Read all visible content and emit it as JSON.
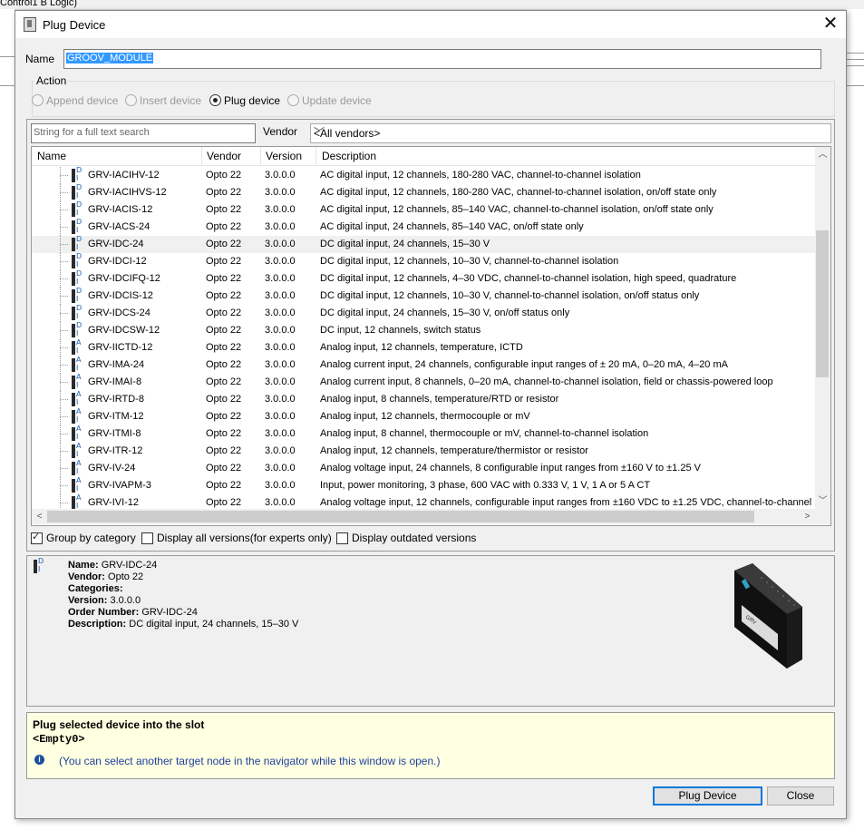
{
  "background": {
    "fragment": "Control1 B Logic)"
  },
  "dialog": {
    "title": "Plug Device"
  },
  "name_field": {
    "label": "Name",
    "value": "GROOV_MODULE"
  },
  "action": {
    "legend": "Action",
    "options": [
      {
        "label": "Append device",
        "selected": false,
        "enabled": false
      },
      {
        "label": "Insert device",
        "selected": false,
        "enabled": false
      },
      {
        "label": "Plug device",
        "selected": true,
        "enabled": true
      },
      {
        "label": "Update device",
        "selected": false,
        "enabled": false
      }
    ]
  },
  "search": {
    "placeholder": "String for a full text search"
  },
  "vendor": {
    "label": "Vendor",
    "selected": "<All vendors>"
  },
  "table": {
    "columns": [
      "Name",
      "Vendor",
      "Version",
      "Description"
    ],
    "selected_index": 4,
    "rows": [
      {
        "icon": "D",
        "name": "GRV-IACIHV-12",
        "vendor": "Opto 22",
        "version": "3.0.0.0",
        "description": "AC digital input, 12 channels, 180-280 VAC, channel-to-channel isolation"
      },
      {
        "icon": "D",
        "name": "GRV-IACIHVS-12",
        "vendor": "Opto 22",
        "version": "3.0.0.0",
        "description": "AC digital input, 12 channels, 180-280 VAC, channel-to-channel isolation, on/off state only"
      },
      {
        "icon": "D",
        "name": "GRV-IACIS-12",
        "vendor": "Opto 22",
        "version": "3.0.0.0",
        "description": "AC digital input, 12 channels, 85–140 VAC, channel-to-channel isolation, on/off state only"
      },
      {
        "icon": "D",
        "name": "GRV-IACS-24",
        "vendor": "Opto 22",
        "version": "3.0.0.0",
        "description": "AC digital input, 24 channels, 85–140 VAC, on/off state only"
      },
      {
        "icon": "D",
        "name": "GRV-IDC-24",
        "vendor": "Opto 22",
        "version": "3.0.0.0",
        "description": "DC digital input, 24 channels, 15–30 V"
      },
      {
        "icon": "D",
        "name": "GRV-IDCI-12",
        "vendor": "Opto 22",
        "version": "3.0.0.0",
        "description": "DC digital input, 12 channels, 10–30 V, channel-to-channel isolation"
      },
      {
        "icon": "D",
        "name": "GRV-IDCIFQ-12",
        "vendor": "Opto 22",
        "version": "3.0.0.0",
        "description": "DC digital input, 12 channels, 4–30 VDC, channel-to-channel isolation, high speed, quadrature"
      },
      {
        "icon": "D",
        "name": "GRV-IDCIS-12",
        "vendor": "Opto 22",
        "version": "3.0.0.0",
        "description": "DC digital input, 12 channels, 10–30 V, channel-to-channel isolation, on/off status only"
      },
      {
        "icon": "D",
        "name": "GRV-IDCS-24",
        "vendor": "Opto 22",
        "version": "3.0.0.0",
        "description": "DC digital input, 24 channels, 15–30 V, on/off status only"
      },
      {
        "icon": "D",
        "name": "GRV-IDCSW-12",
        "vendor": "Opto 22",
        "version": "3.0.0.0",
        "description": "DC input, 12 channels, switch status"
      },
      {
        "icon": "A",
        "name": "GRV-IICTD-12",
        "vendor": "Opto 22",
        "version": "3.0.0.0",
        "description": "Analog input, 12 channels, temperature, ICTD"
      },
      {
        "icon": "A",
        "name": "GRV-IMA-24",
        "vendor": "Opto 22",
        "version": "3.0.0.0",
        "description": "Analog current input, 24 channels, configurable input ranges of ± 20 mA, 0–20 mA, 4–20 mA"
      },
      {
        "icon": "A",
        "name": "GRV-IMAI-8",
        "vendor": "Opto 22",
        "version": "3.0.0.0",
        "description": "Analog current input, 8 channels, 0–20 mA, channel-to-channel isolation, field or chassis-powered loop"
      },
      {
        "icon": "A",
        "name": "GRV-IRTD-8",
        "vendor": "Opto 22",
        "version": "3.0.0.0",
        "description": "Analog input, 8 channels, temperature/RTD or resistor"
      },
      {
        "icon": "A",
        "name": "GRV-ITM-12",
        "vendor": "Opto 22",
        "version": "3.0.0.0",
        "description": "Analog input, 12 channels, thermocouple or mV"
      },
      {
        "icon": "A",
        "name": "GRV-ITMI-8",
        "vendor": "Opto 22",
        "version": "3.0.0.0",
        "description": "Analog input, 8 channel, thermocouple or mV, channel-to-channel isolation"
      },
      {
        "icon": "A",
        "name": "GRV-ITR-12",
        "vendor": "Opto 22",
        "version": "3.0.0.0",
        "description": "Analog input, 12 channels, temperature/thermistor or resistor"
      },
      {
        "icon": "A",
        "name": "GRV-IV-24",
        "vendor": "Opto 22",
        "version": "3.0.0.0",
        "description": "Analog voltage input, 24 channels, 8 configurable input ranges from ±160 V to ±1.25 V"
      },
      {
        "icon": "A",
        "name": "GRV-IVAPM-3",
        "vendor": "Opto 22",
        "version": "3.0.0.0",
        "description": "Input, power monitoring, 3 phase, 600 VAC with 0.333 V, 1 V, 1 A or 5 A CT"
      },
      {
        "icon": "A",
        "name": "GRV-IVI-12",
        "vendor": "Opto 22",
        "version": "3.0.0.0",
        "description": "Analog voltage input, 12 channels, configurable input ranges from ±160 VDC to ±1.25 VDC, channel-to-channel is"
      }
    ]
  },
  "options": {
    "group_by_category": {
      "label": "Group by category",
      "checked": true
    },
    "display_all_versions": {
      "label": "Display all versions(for experts only)",
      "checked": false
    },
    "display_outdated": {
      "label": "Display outdated versions",
      "checked": false
    }
  },
  "details": {
    "name_label": "Name:",
    "name": "GRV-IDC-24",
    "vendor_label": "Vendor:",
    "vendor": "Opto 22",
    "categories_label": "Categories:",
    "categories": "",
    "version_label": "Version:",
    "version": "3.0.0.0",
    "order_label": "Order Number:",
    "order_number": "GRV-IDC-24",
    "description_label": "Description:",
    "description": "DC digital input, 24 channels, 15–30 V"
  },
  "note": {
    "line1": "Plug selected device into the slot",
    "line2": "<Empty0>",
    "line3": "(You can select another target node in the navigator while this window is open.)"
  },
  "buttons": {
    "plug": "Plug Device",
    "close": "Close"
  }
}
